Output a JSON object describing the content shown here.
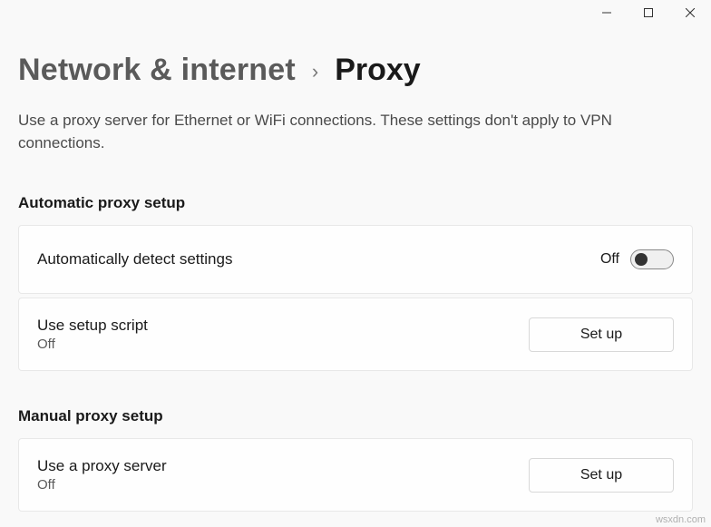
{
  "breadcrumb": {
    "parent": "Network & internet",
    "current": "Proxy"
  },
  "description": "Use a proxy server for Ethernet or WiFi connections. These settings don't apply to VPN connections.",
  "sections": {
    "auto": {
      "header": "Automatic proxy setup",
      "detect": {
        "label": "Automatically detect settings",
        "state": "Off"
      },
      "script": {
        "label": "Use setup script",
        "sub": "Off",
        "button": "Set up"
      }
    },
    "manual": {
      "header": "Manual proxy setup",
      "proxy": {
        "label": "Use a proxy server",
        "sub": "Off",
        "button": "Set up"
      }
    }
  },
  "watermark": "wsxdn.com"
}
